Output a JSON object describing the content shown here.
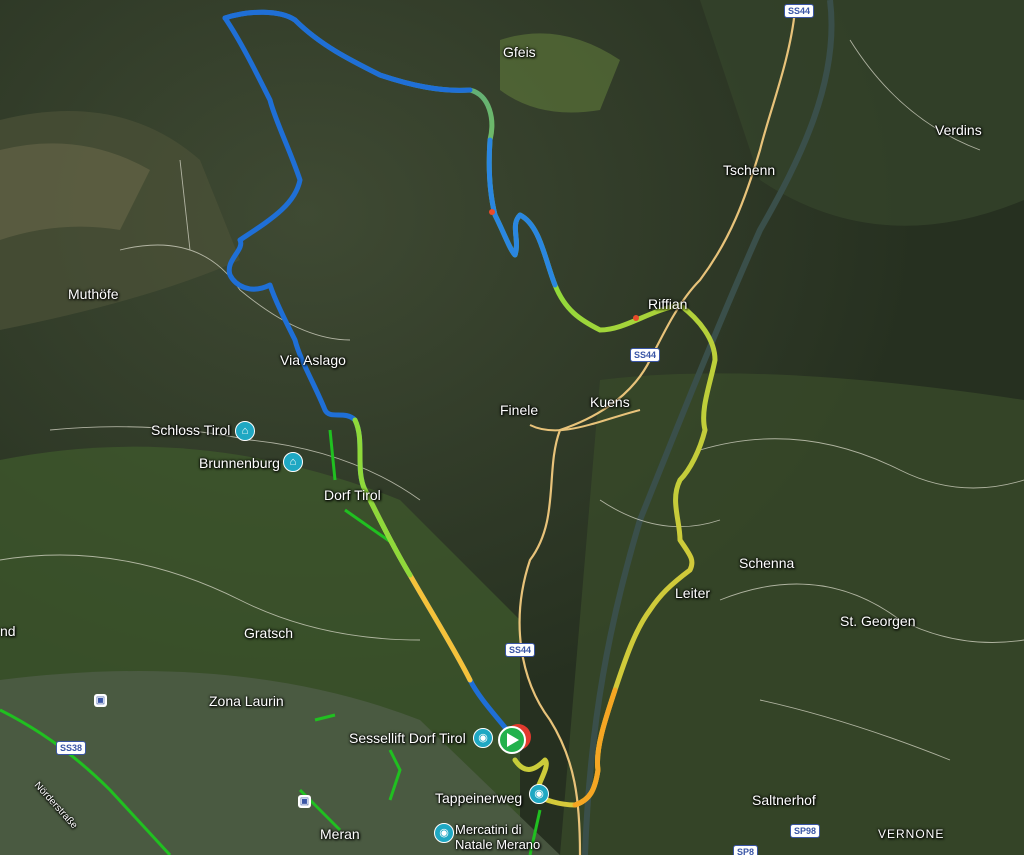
{
  "labels": {
    "gfeis": "Gfeis",
    "verdins": "Verdins",
    "tschenn": "Tschenn",
    "muthofe": "Muthöfe",
    "riffian": "Riffian",
    "via_aslago": "Via Aslago",
    "finele": "Finele",
    "kuens": "Kuens",
    "schloss_tirol": "Schloss Tirol",
    "brunnenburg": "Brunnenburg",
    "dorf_tirol": "Dorf Tirol",
    "schenna": "Schenna",
    "leiter": "Leiter",
    "st_georgen": "St. Georgen",
    "gratsch": "Gratsch",
    "zona_laurin": "Zona Laurin",
    "sessellift": "Sessellift Dorf Tirol",
    "tappeinerweg": "Tappeinerweg",
    "saltnerhof": "Saltnerhof",
    "meran": "Meran",
    "mercatini_1": "Mercatini di",
    "mercatini_2": "Natale Merano",
    "vernone": "VERNONE",
    "nordersstrasse": "Nörderstraße",
    "edge_nd": "nd"
  },
  "road_shields": {
    "ss44_top": "SS44",
    "ss44_mid": "SS44",
    "ss44_low": "SS44",
    "ss38": "SS38",
    "sp98": "SP98",
    "sp8": "SP8"
  },
  "icons": {
    "poi": "museum-icon",
    "gondola": "camera-icon",
    "start": "start-play-marker-icon",
    "end": "end-marker-icon",
    "train": "train-station-icon"
  },
  "colors": {
    "route_slow": "#1f6fd6",
    "route_mid": "#8fd93a",
    "route_fast": "#f5c23a",
    "route_peak": "#e84b2b",
    "green_path": "#20c020",
    "road": "#e8c37a",
    "poi": "#1fa8c3",
    "start": "#22b14c",
    "end": "#e23a2e"
  }
}
